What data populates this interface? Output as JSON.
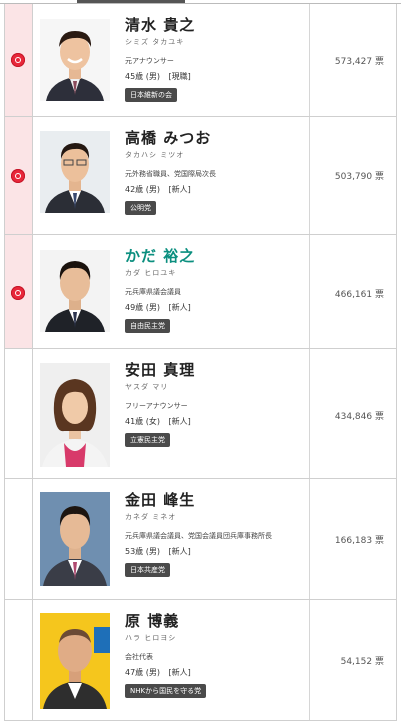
{
  "candidates": [
    {
      "name": "清水 貴之",
      "kana": "シミズ タカユキ",
      "career": "元アナウンサー",
      "age": "45歳 (男)",
      "status": "[現職]",
      "party": "日本維新の会",
      "votes": "573,427",
      "unit": "票",
      "elected": true,
      "name_color": "#222222"
    },
    {
      "name": "高橋 みつお",
      "kana": "タカハシ ミツオ",
      "career": "元外務省職員、党国際局次長",
      "age": "42歳 (男)",
      "status": "[新人]",
      "party": "公明党",
      "votes": "503,790",
      "unit": "票",
      "elected": true,
      "name_color": "#222222"
    },
    {
      "name": "かだ 裕之",
      "kana": "カダ ヒロユキ",
      "career": "元兵庫県議会議員",
      "age": "49歳 (男)",
      "status": "[新人]",
      "party": "自由民主党",
      "votes": "466,161",
      "unit": "票",
      "elected": true,
      "name_color": "#0b8f7f"
    },
    {
      "name": "安田 真理",
      "kana": "ヤスダ マリ",
      "career": "フリーアナウンサー",
      "age": "41歳 (女)",
      "status": "[新人]",
      "party": "立憲民主党",
      "votes": "434,846",
      "unit": "票",
      "elected": false,
      "name_color": "#222222"
    },
    {
      "name": "金田 峰生",
      "kana": "カネダ ミネオ",
      "career": "元兵庫県議会議員、党国会議員団兵庫事務所長",
      "age": "53歳 (男)",
      "status": "[新人]",
      "party": "日本共産党",
      "votes": "166,183",
      "unit": "票",
      "elected": false,
      "name_color": "#222222"
    },
    {
      "name": "原 博義",
      "kana": "ハラ ヒロヨシ",
      "career": "会社代表",
      "age": "47歳 (男)",
      "status": "[新人]",
      "party": "NHKから国民を守る党",
      "votes": "54,152",
      "unit": "票",
      "elected": false,
      "name_color": "#222222"
    }
  ],
  "icons": {
    "elected": "rose-icon"
  },
  "colors": {
    "elected_bg": "#fbe4e6",
    "rose": "#e8273a",
    "party_badge": "#4a4a4a"
  }
}
